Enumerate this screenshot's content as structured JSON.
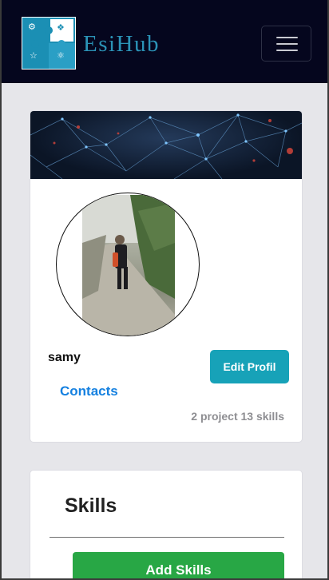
{
  "navbar": {
    "brand": "EsiHub",
    "logo_icon": "puzzle-logo",
    "menu_icon": "hamburger-icon"
  },
  "profile": {
    "cover_icon": "network-banner",
    "avatar_icon": "user-photo",
    "name": "samy",
    "contacts_label": "Contacts",
    "edit_label": "Edit Profil",
    "stats": "2 project 13 skills"
  },
  "skills": {
    "title": "Skills",
    "add_label": "Add Skills"
  },
  "colors": {
    "navbar_bg": "#05061e",
    "brand": "#2b93b7",
    "page_bg": "#e6e6ea",
    "edit_button": "#17a2b8",
    "link": "#1480e0",
    "add_button": "#28a745"
  }
}
